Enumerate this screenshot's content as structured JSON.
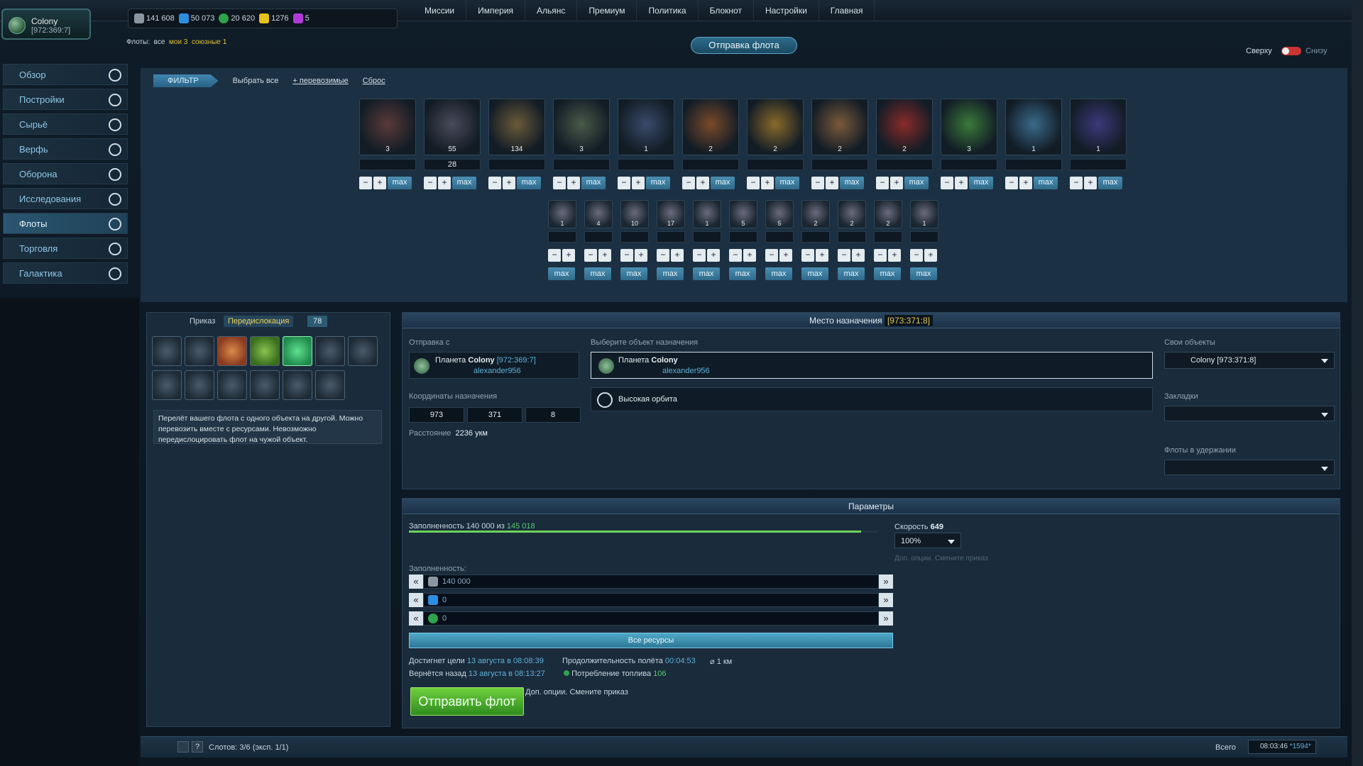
{
  "colony": {
    "name": "Colony",
    "coords": "[972:369:7]"
  },
  "resources": {
    "metal": "141 608",
    "crystal": "50 073",
    "deut": "20 620",
    "energy": "1276",
    "dm": "5"
  },
  "nav": [
    "Миссии",
    "Империя",
    "Альянс",
    "Премиум",
    "Политика",
    "Блокнот",
    "Настройки",
    "Главная"
  ],
  "fleets_line": {
    "prefix": "Флоты:",
    "all": "все",
    "mine": "мои 3",
    "allied": "союзные 1"
  },
  "sidebar": [
    "Обзор",
    "Постройки",
    "Сырьё",
    "Верфь",
    "Оборона",
    "Исследования",
    "Флоты",
    "Торговля",
    "Галактика"
  ],
  "title": "Отправка флота",
  "toggle": {
    "top": "Сверху",
    "bottom": "Снизу"
  },
  "filter": {
    "filter": "ФИЛЬТР",
    "select_all": "Выбрать все",
    "transportable": "+ перевозимые",
    "reset": "Сброс"
  },
  "ships_row1": [
    {
      "count": "3",
      "qty": ""
    },
    {
      "count": "55",
      "qty": "28"
    },
    {
      "count": "134",
      "qty": ""
    },
    {
      "count": "3",
      "qty": ""
    },
    {
      "count": "1",
      "qty": ""
    },
    {
      "count": "2",
      "qty": ""
    },
    {
      "count": "2",
      "qty": ""
    },
    {
      "count": "2",
      "qty": ""
    },
    {
      "count": "2",
      "qty": ""
    },
    {
      "count": "3",
      "qty": ""
    },
    {
      "count": "1",
      "qty": ""
    },
    {
      "count": "1",
      "qty": ""
    }
  ],
  "ships_row2": [
    "1",
    "4",
    "10",
    "17",
    "1",
    "5",
    "5",
    "2",
    "2",
    "2",
    "1"
  ],
  "max_label": "max",
  "order": {
    "label": "Приказ",
    "value": "Передислокация",
    "count": "78"
  },
  "mission_desc": "Перелёт вашего флота с одного объекта на другой. Можно перевозить вместе с ресурсами. Невозможно передислоцировать флот на чужой объект.",
  "destination": {
    "header": "Место назначения",
    "coords": "[973:371:8]"
  },
  "from": {
    "label": "Отправка с",
    "planet_prefix": "Планета",
    "planet": "Colony",
    "coord": "[972:369:7]",
    "owner": "alexander956"
  },
  "target": {
    "label": "Выберите объект назначения",
    "planet_prefix": "Планета",
    "planet": "Colony",
    "owner": "alexander956",
    "orbit": "Высокая орбита"
  },
  "coords_label": "Координаты назначения",
  "coords": [
    "973",
    "371",
    "8"
  ],
  "distance": {
    "label": "Расстояние",
    "value": "2236 укм"
  },
  "own_objects": {
    "label": "Свои объекты",
    "value": "Colony [973:371:8]"
  },
  "bookmarks": {
    "label": "Закладки",
    "value": ""
  },
  "held_fleets": {
    "label": "Флоты в удержании",
    "value": ""
  },
  "params": {
    "header": "Параметры",
    "capacity_label": "Заполненность 140 000 из",
    "capacity_max": "145 018",
    "speed_label": "Скорость",
    "speed": "649",
    "speed_pct": "100%",
    "extra": "Доп. опции. Смените приказ"
  },
  "cargo_label": "Заполненность:",
  "cargo": [
    "140 000",
    "0",
    "0"
  ],
  "all_resources": "Все ресурсы",
  "arrival": {
    "label": "Достигнет цели",
    "value": "13 августа в 08:08:39"
  },
  "duration": {
    "label": "Продолжительность полёта",
    "value": "00:04:53"
  },
  "range": "1 км",
  "return": {
    "label": "Вернётся назад",
    "value": "13 августа в 08:13:27"
  },
  "fuel": {
    "label": "Потребление топлива",
    "value": "106"
  },
  "extra_bottom": "Доп. опции. Смените приказ",
  "send": "Отправить флот",
  "slots": "Слотов: 3/6 (эксп. 1/1)",
  "total": "Всего",
  "clock": "08:03:46",
  "clock_extra": "*1594*"
}
